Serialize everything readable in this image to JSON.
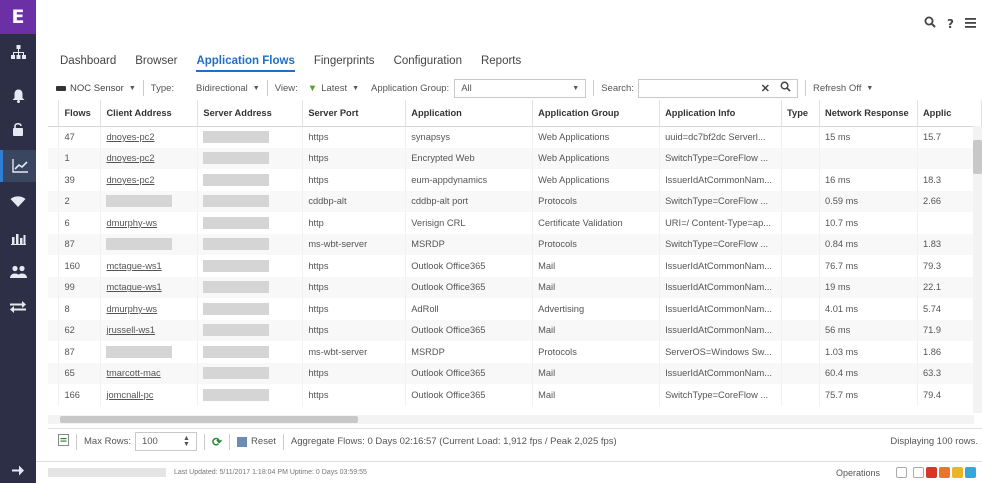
{
  "brand": {
    "logo": "E"
  },
  "sidebar": {
    "items": [
      {
        "icon": "network-tree-icon"
      },
      {
        "icon": "bell-icon"
      },
      {
        "icon": "lock-icon"
      },
      {
        "icon": "line-chart-icon",
        "active": true
      },
      {
        "icon": "wifi-icon"
      },
      {
        "icon": "bar-chart-icon"
      },
      {
        "icon": "users-icon"
      },
      {
        "icon": "transfer-arrows-icon"
      }
    ],
    "expand_icon": "arrow-right-icon"
  },
  "topbar": {
    "help": "?"
  },
  "tabs": [
    "Dashboard",
    "Browser",
    "Application Flows",
    "Fingerprints",
    "Configuration",
    "Reports"
  ],
  "active_tab": "Application Flows",
  "toolbar": {
    "sensor": "NOC Sensor",
    "type_label": "Type:",
    "type_value": "Bidirectional",
    "view_label": "View:",
    "view_value": "Latest",
    "group_label": "Application Group:",
    "group_value": "All",
    "search_label": "Search:",
    "search_value": "",
    "refresh": "Refresh Off"
  },
  "table": {
    "columns": [
      "Flows",
      "Client Address",
      "Server Address",
      "Server Port",
      "Application",
      "Application Group",
      "Application Info",
      "Type",
      "Network Response",
      "Applic"
    ],
    "rows": [
      [
        "47",
        "dnoyes-pc2",
        "",
        "https",
        "synapsys",
        "Web Applications",
        "uuid=dc7bf2dc Serverl...",
        "",
        "15 ms",
        "15.7"
      ],
      [
        "1",
        "dnoyes-pc2",
        "",
        "https",
        "Encrypted Web",
        "Web Applications",
        "SwitchType=CoreFlow ...",
        "",
        "",
        ""
      ],
      [
        "39",
        "dnoyes-pc2",
        "",
        "https",
        "eum-appdynamics",
        "Web Applications",
        "IssuerIdAtCommonNam...",
        "",
        "16 ms",
        "18.3"
      ],
      [
        "2",
        "",
        "",
        "cddbp-alt",
        "cddbp-alt port",
        "Protocols",
        "SwitchType=CoreFlow ...",
        "",
        "0.59 ms",
        "2.66"
      ],
      [
        "6",
        "dmurphy-ws",
        "",
        "http",
        "Verisign CRL",
        "Certificate Validation",
        "URI=/ Content-Type=ap...",
        "",
        "10.7 ms",
        ""
      ],
      [
        "87",
        "",
        "",
        "ms-wbt-server",
        "MSRDP",
        "Protocols",
        "SwitchType=CoreFlow ...",
        "",
        "0.84 ms",
        "1.83"
      ],
      [
        "160",
        "mctague-ws1",
        "",
        "https",
        "Outlook Office365",
        "Mail",
        "IssuerIdAtCommonNam...",
        "",
        "76.7 ms",
        "79.3"
      ],
      [
        "99",
        "mctague-ws1",
        "",
        "https",
        "Outlook Office365",
        "Mail",
        "IssuerIdAtCommonNam...",
        "",
        "19 ms",
        "22.1"
      ],
      [
        "8",
        "dmurphy-ws",
        "",
        "https",
        "AdRoll",
        "Advertising",
        "IssuerIdAtCommonNam...",
        "",
        "4.01 ms",
        "5.74"
      ],
      [
        "62",
        "jrussell-ws1",
        "",
        "https",
        "Outlook Office365",
        "Mail",
        "IssuerIdAtCommonNam...",
        "",
        "56 ms",
        "71.9"
      ],
      [
        "87",
        "",
        "",
        "ms-wbt-server",
        "MSRDP",
        "Protocols",
        "ServerOS=Windows Sw...",
        "",
        "1.03 ms",
        "1.86"
      ],
      [
        "65",
        "tmarcott-mac",
        "",
        "https",
        "Outlook Office365",
        "Mail",
        "IssuerIdAtCommonNam...",
        "",
        "60.4 ms",
        "63.3"
      ],
      [
        "166",
        "jomcnall-pc",
        "",
        "https",
        "Outlook Office365",
        "Mail",
        "SwitchType=CoreFlow ...",
        "",
        "75.7 ms",
        "79.4"
      ]
    ]
  },
  "footer": {
    "max_rows_label": "Max Rows:",
    "max_rows_value": "100",
    "reset": "Reset",
    "aggregate": "Aggregate Flows: 0 Days 02:16:57 (Current Load: 1,912 fps / Peak 2,025 fps)",
    "displaying": "Displaying 100 rows."
  },
  "status": {
    "last_updated": "Last Updated: 5/11/2017 1:18:04 PM  Uptime: 0 Days 03:59:55",
    "operations": "Operations"
  },
  "colors": {
    "accent": "#1f6fc4",
    "logo_bg": "#6b2fa6",
    "sidebar_bg": "#2d2f46"
  }
}
